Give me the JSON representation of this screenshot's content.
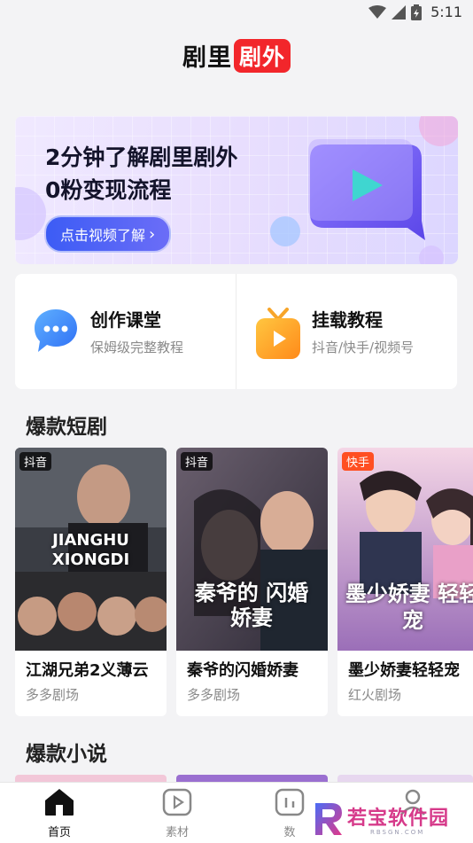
{
  "status_bar": {
    "time": "5:11",
    "icons": [
      "wifi-icon",
      "signal-icon",
      "battery-icon"
    ]
  },
  "header": {
    "logo_main": "剧里",
    "logo_badge": "剧外",
    "badge_color": "#f2262b"
  },
  "banner": {
    "title_line1": "2分钟了解剧里剧外",
    "title_line2": "0粉变现流程",
    "button_label": "点击视频了解",
    "chevron": "›"
  },
  "features": [
    {
      "title": "创作课堂",
      "subtitle": "保姆级完整教程",
      "icon": "chat-bubble-icon"
    },
    {
      "title": "挂载教程",
      "subtitle": "抖音/快手/视频号",
      "icon": "tv-play-icon"
    }
  ],
  "sections": {
    "dramas_title": "爆款短剧",
    "novels_title": "爆款小说"
  },
  "dramas": [
    {
      "platform": "抖音",
      "name": "江湖兄弟2义薄云",
      "source": "多多剧场",
      "poster_text": "JIANGHU XIONGDI"
    },
    {
      "platform": "抖音",
      "name": "秦爷的闪婚娇妻",
      "source": "多多剧场",
      "poster_text": "秦爷的 闪婚娇妻"
    },
    {
      "platform": "快手",
      "name": "墨少娇妻轻轻宠",
      "source": "红火剧场",
      "poster_text": "墨少娇妻 轻轻宠"
    }
  ],
  "tabbar": [
    {
      "label": "首页",
      "icon": "home-icon",
      "active": true
    },
    {
      "label": "素材",
      "icon": "play-square-icon",
      "active": false
    },
    {
      "label": "数",
      "icon": "chart-icon",
      "active": false
    },
    {
      "label": "",
      "icon": "profile-icon",
      "active": false
    }
  ],
  "watermark": {
    "text": "若宝软件园",
    "sub": "RBSGN.COM"
  }
}
